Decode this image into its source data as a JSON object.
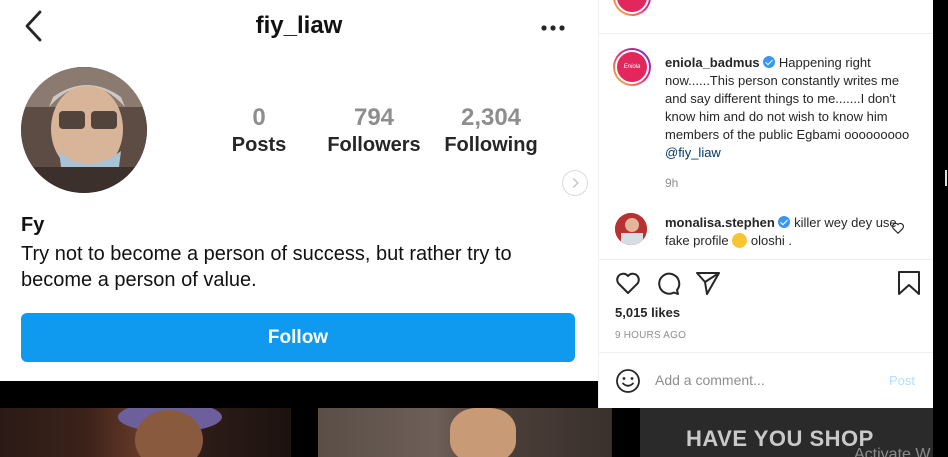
{
  "profile": {
    "username": "fiy_liaw",
    "stats": [
      {
        "value": "0",
        "label": "Posts"
      },
      {
        "value": "794",
        "label": "Followers"
      },
      {
        "value": "2,304",
        "label": "Following"
      }
    ],
    "name": "Fy",
    "bio": "Try not to become a person of success, but rather try to become a person of value.",
    "follow_label": "Follow"
  },
  "post": {
    "caption_username": "eniola_badmus",
    "caption_text": "Happening right now......This person constantly writes me and say different things to me.......I don't know him and do not wish to know him members of the public Egbami ooooooooo",
    "caption_mention": "@fiy_liaw",
    "caption_time": "9h",
    "comment_username": "monalisa.stephen",
    "comment_text_before": "killer wey dey use fake profile",
    "comment_text_after": "oloshi .",
    "likes": "5,015 likes",
    "time_ago": "9 HOURS AGO",
    "add_comment_placeholder": "Add a comment...",
    "post_button": "Post"
  },
  "thumbnails": {
    "third_text": "HAVE YOU SHOP"
  },
  "watermark": "Activate W",
  "colors": {
    "follow_blue": "#0f9af0",
    "verified_blue": "#3897f0",
    "mention_blue": "#00376b",
    "post_button_disabled": "#b2dffc"
  }
}
